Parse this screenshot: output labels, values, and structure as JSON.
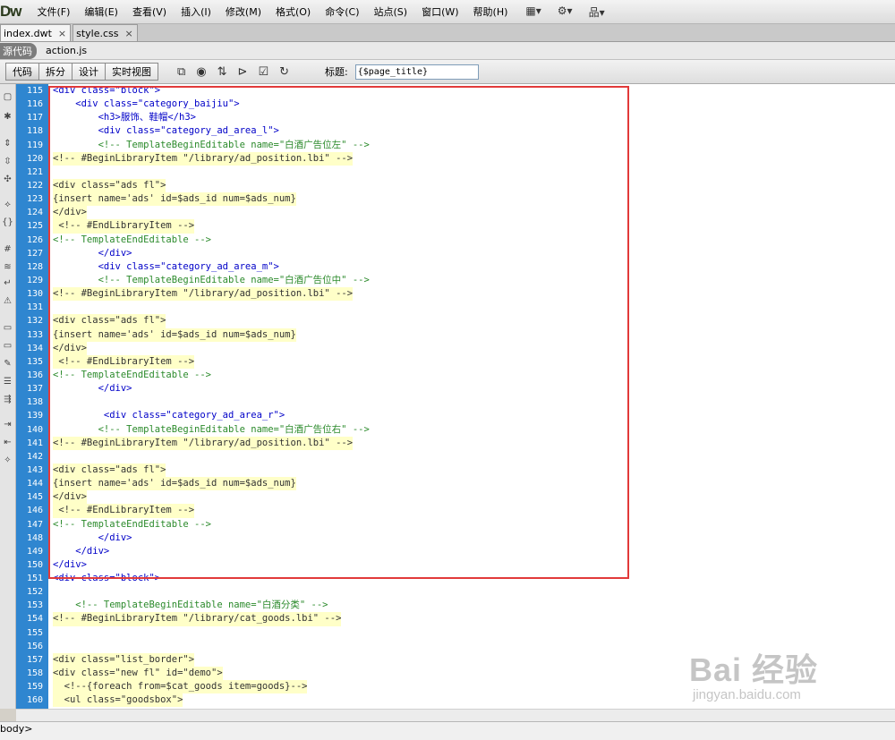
{
  "app": {
    "logo": "Dw"
  },
  "menu": [
    "文件(F)",
    "编辑(E)",
    "查看(V)",
    "插入(I)",
    "修改(M)",
    "格式(O)",
    "命令(C)",
    "站点(S)",
    "窗口(W)",
    "帮助(H)"
  ],
  "menu_icons": [
    {
      "name": "layout-icon",
      "glyph": "▦▾"
    },
    {
      "name": "gear-icon",
      "glyph": "⚙▾"
    },
    {
      "name": "site-icon",
      "glyph": "品▾"
    }
  ],
  "tabs": [
    {
      "label": "index.dwt",
      "close": "×",
      "active": true
    },
    {
      "label": "style.css",
      "close": "×",
      "active": false
    }
  ],
  "related": {
    "source": "源代码",
    "file": "action.js"
  },
  "toolbar": {
    "views": [
      "代码",
      "拆分",
      "设计",
      "实时视图"
    ],
    "title_label": "标题:",
    "title_value": "{$page_title}"
  },
  "code_lines": [
    {
      "n": "115",
      "t": "<div class=\"block\">",
      "k": "tag"
    },
    {
      "n": "116",
      "t": "    <div class=\"category_baijiu\">",
      "k": "tag"
    },
    {
      "n": "117",
      "t": "        <h3>服饰、鞋帽</h3>",
      "k": "tag"
    },
    {
      "n": "118",
      "t": "        <div class=\"category_ad_area_l\">",
      "k": "tag"
    },
    {
      "n": "119",
      "t": "        <!-- TemplateBeginEditable name=\"白酒广告位左\" -->",
      "k": "cmt"
    },
    {
      "n": "120",
      "t": "<!-- #BeginLibraryItem \"/library/ad_position.lbi\" -->",
      "k": "lib"
    },
    {
      "n": "121",
      "t": "",
      "k": "plain"
    },
    {
      "n": "122",
      "t": "<div class=\"ads fl\">",
      "k": "lib"
    },
    {
      "n": "123",
      "t": "{insert name='ads' id=$ads_id num=$ads_num}",
      "k": "lib"
    },
    {
      "n": "124",
      "t": "</div>",
      "k": "lib"
    },
    {
      "n": "125",
      "t": " <!-- #EndLibraryItem -->",
      "k": "lib"
    },
    {
      "n": "126",
      "t": "<!-- TemplateEndEditable -->",
      "k": "cmt"
    },
    {
      "n": "127",
      "t": "        </div>",
      "k": "tag"
    },
    {
      "n": "128",
      "t": "        <div class=\"category_ad_area_m\">",
      "k": "tag"
    },
    {
      "n": "129",
      "t": "        <!-- TemplateBeginEditable name=\"白酒广告位中\" -->",
      "k": "cmt"
    },
    {
      "n": "130",
      "t": "<!-- #BeginLibraryItem \"/library/ad_position.lbi\" -->",
      "k": "lib"
    },
    {
      "n": "131",
      "t": "",
      "k": "plain"
    },
    {
      "n": "132",
      "t": "<div class=\"ads fl\">",
      "k": "lib"
    },
    {
      "n": "133",
      "t": "{insert name='ads' id=$ads_id num=$ads_num}",
      "k": "lib"
    },
    {
      "n": "134",
      "t": "</div>",
      "k": "lib"
    },
    {
      "n": "135",
      "t": " <!-- #EndLibraryItem -->",
      "k": "lib"
    },
    {
      "n": "136",
      "t": "<!-- TemplateEndEditable -->",
      "k": "cmt"
    },
    {
      "n": "137",
      "t": "        </div>",
      "k": "tag"
    },
    {
      "n": "138",
      "t": "",
      "k": "plain"
    },
    {
      "n": "139",
      "t": "         <div class=\"category_ad_area_r\">",
      "k": "tag"
    },
    {
      "n": "140",
      "t": "        <!-- TemplateBeginEditable name=\"白酒广告位右\" -->",
      "k": "cmt"
    },
    {
      "n": "141",
      "t": "<!-- #BeginLibraryItem \"/library/ad_position.lbi\" -->",
      "k": "lib"
    },
    {
      "n": "142",
      "t": "",
      "k": "plain"
    },
    {
      "n": "143",
      "t": "<div class=\"ads fl\">",
      "k": "lib"
    },
    {
      "n": "144",
      "t": "{insert name='ads' id=$ads_id num=$ads_num}",
      "k": "lib"
    },
    {
      "n": "145",
      "t": "</div>",
      "k": "lib"
    },
    {
      "n": "146",
      "t": " <!-- #EndLibraryItem -->",
      "k": "lib"
    },
    {
      "n": "147",
      "t": "<!-- TemplateEndEditable -->",
      "k": "cmt"
    },
    {
      "n": "148",
      "t": "        </div>",
      "k": "tag"
    },
    {
      "n": "149",
      "t": "    </div>",
      "k": "tag"
    },
    {
      "n": "150",
      "t": "</div>",
      "k": "tag"
    },
    {
      "n": "151",
      "t": "<div class=\"block\">",
      "k": "tag"
    },
    {
      "n": "152",
      "t": "",
      "k": "plain"
    },
    {
      "n": "153",
      "t": "    <!-- TemplateBeginEditable name=\"白酒分类\" -->",
      "k": "cmt"
    },
    {
      "n": "154",
      "t": "<!-- #BeginLibraryItem \"/library/cat_goods.lbi\" -->",
      "k": "lib"
    },
    {
      "n": "155",
      "t": "",
      "k": "plain"
    },
    {
      "n": "156",
      "t": "",
      "k": "plain"
    },
    {
      "n": "157",
      "t": "<div class=\"list_border\">",
      "k": "lib"
    },
    {
      "n": "158",
      "t": "<div class=\"new fl\" id=\"demo\">",
      "k": "lib"
    },
    {
      "n": "159",
      "t": "  <!--{foreach from=$cat_goods item=goods}-->",
      "k": "lib"
    },
    {
      "n": "160",
      "t": "  <ul class=\"goodsbox\">",
      "k": "lib"
    }
  ],
  "status": {
    "tag": "body>"
  },
  "watermark": {
    "main": "Bai 经验",
    "sub": "jingyan.baidu.com"
  }
}
